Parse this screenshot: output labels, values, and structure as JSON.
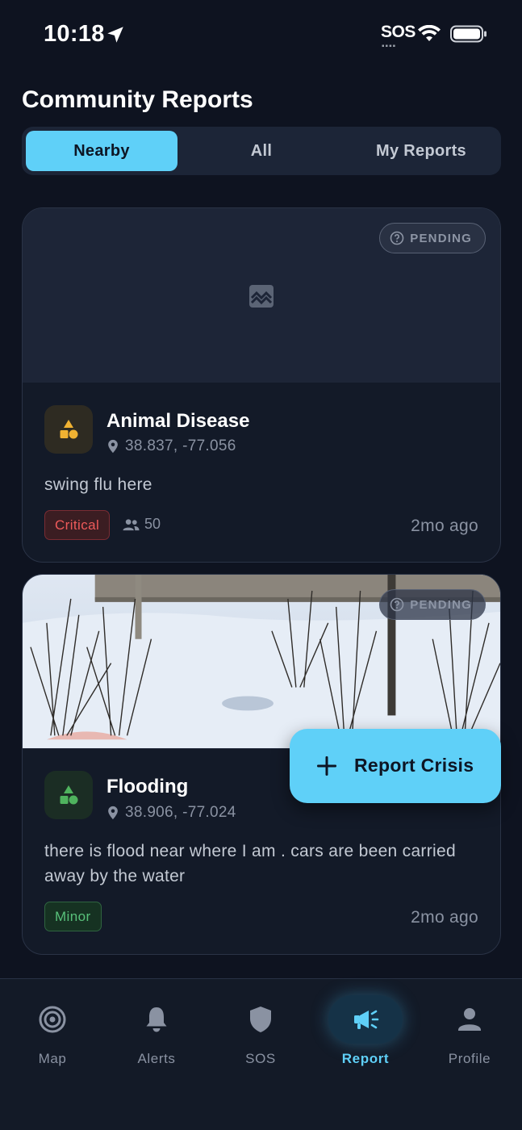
{
  "status_bar": {
    "time": "10:18",
    "sos": "SOS"
  },
  "page": {
    "title": "Community Reports"
  },
  "tabs": [
    {
      "label": "Nearby",
      "active": true
    },
    {
      "label": "All",
      "active": false
    },
    {
      "label": "My Reports",
      "active": false
    }
  ],
  "reports": [
    {
      "status": "PENDING",
      "category": "Animal Disease",
      "coords": "38.837, -77.056",
      "description": "swing flu here",
      "severity": "Critical",
      "people_count": "50",
      "time_ago": "2mo ago",
      "accent_color": "#f0b232",
      "has_photo": false
    },
    {
      "status": "PENDING",
      "category": "Flooding",
      "coords": "38.906, -77.024",
      "description": "there is flood near where I am . cars are been carried away by the water",
      "severity": "Minor",
      "time_ago": "2mo ago",
      "accent_color": "#4fb35e",
      "has_photo": true
    }
  ],
  "fab": {
    "label": "Report Crisis"
  },
  "nav": [
    {
      "label": "Map",
      "icon": "target-icon",
      "active": false
    },
    {
      "label": "Alerts",
      "icon": "bell-icon",
      "active": false
    },
    {
      "label": "SOS",
      "icon": "shield-icon",
      "active": false
    },
    {
      "label": "Report",
      "icon": "megaphone-icon",
      "active": true
    },
    {
      "label": "Profile",
      "icon": "person-icon",
      "active": false
    }
  ],
  "colors": {
    "accent": "#5fd0f8",
    "background": "#0e1320",
    "card": "#131a28"
  }
}
